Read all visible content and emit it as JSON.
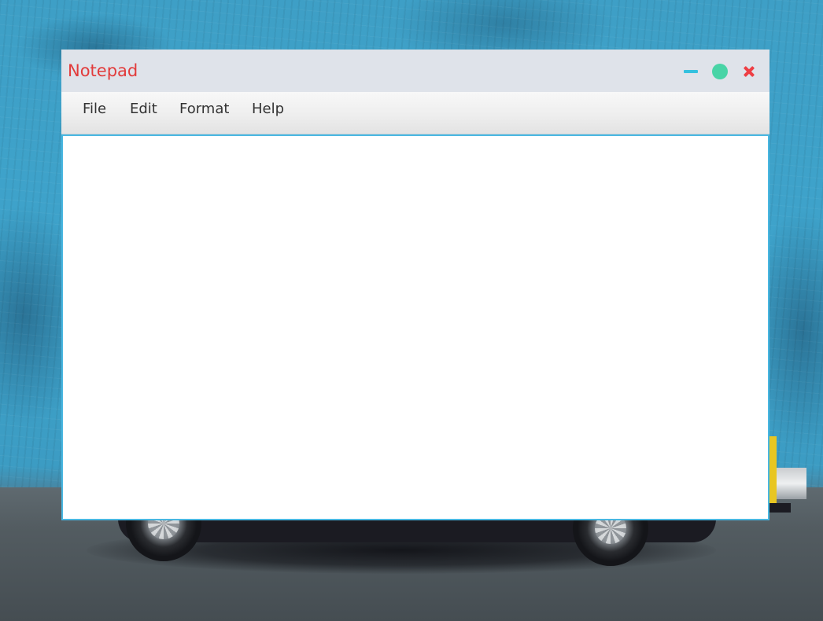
{
  "window": {
    "title": "Notepad",
    "title_color": "#e23b3b",
    "controls": {
      "minimize_icon": "minimize-icon",
      "minimize_color": "#35c1df",
      "maximize_icon": "maximize-icon",
      "maximize_color": "#48d4a6",
      "close_icon": "close-icon",
      "close_color": "#ee3e44"
    }
  },
  "menubar": {
    "items": [
      {
        "label": "File"
      },
      {
        "label": "Edit"
      },
      {
        "label": "Format"
      },
      {
        "label": "Help"
      }
    ]
  },
  "editor": {
    "value": "",
    "border_color": "#49b7e1"
  }
}
